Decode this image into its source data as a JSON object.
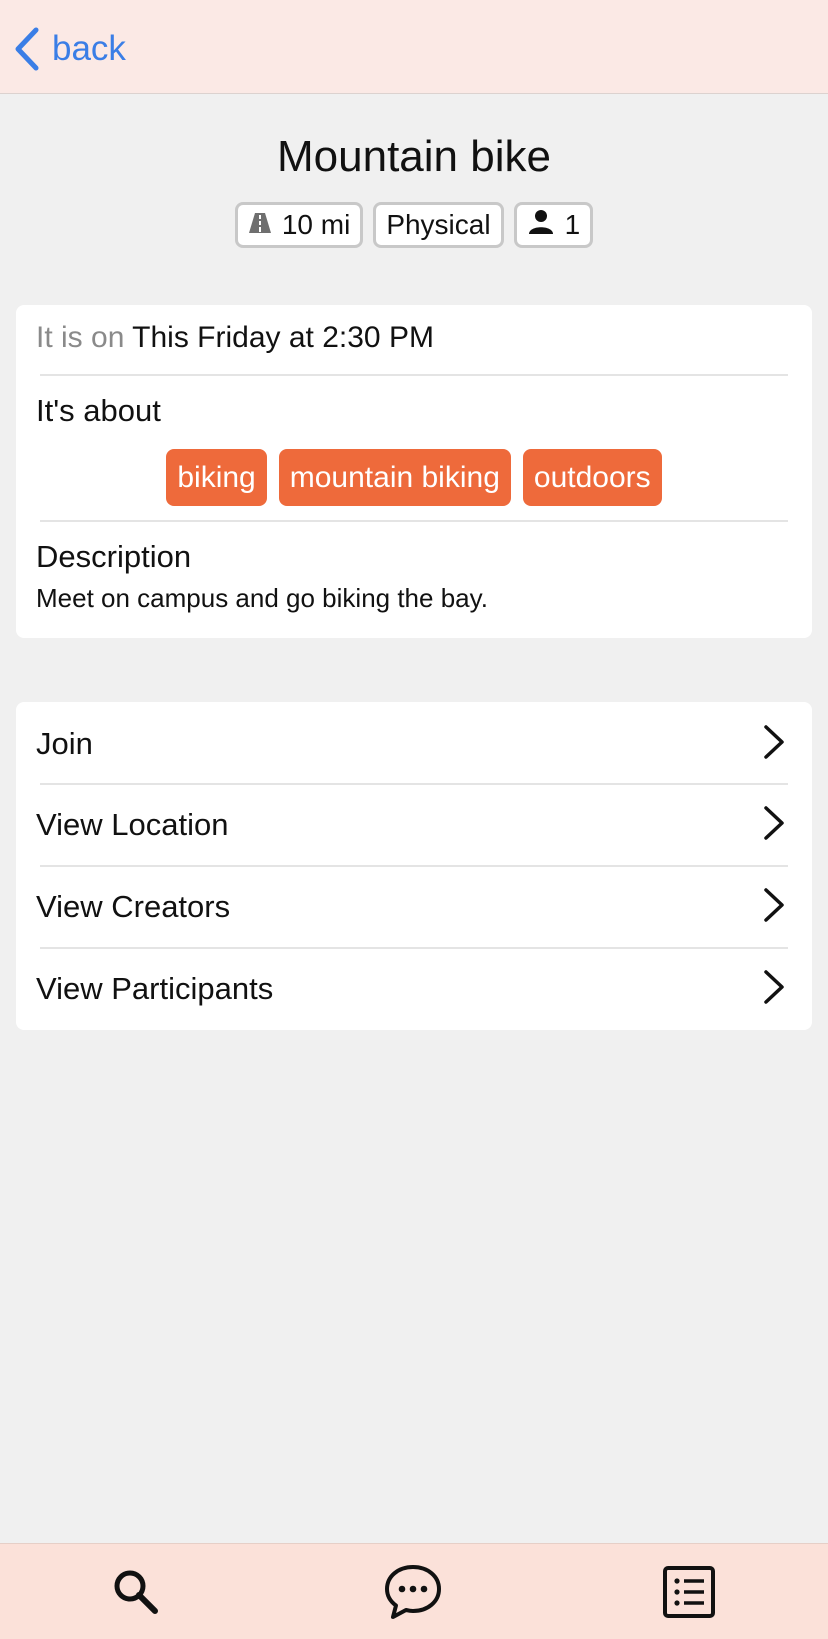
{
  "header": {
    "back_label": "back"
  },
  "event": {
    "title": "Mountain bike",
    "chips": {
      "distance": "10 mi",
      "category": "Physical",
      "participants": "1"
    },
    "datetime_prefix": "It is on",
    "datetime_value": "This Friday at 2:30 PM",
    "about_label": "It's about",
    "tags": [
      "biking",
      "mountain biking",
      "outdoors"
    ],
    "description_label": "Description",
    "description": "Meet on campus and go biking the bay."
  },
  "actions": [
    {
      "label": "Join"
    },
    {
      "label": "View Location"
    },
    {
      "label": "View Creators"
    },
    {
      "label": "View Participants"
    }
  ],
  "tabbar": {
    "icons": [
      "search-icon",
      "chat-bubble-icon",
      "list-icon"
    ]
  },
  "colors": {
    "accent_blue": "#3a7ee6",
    "tag_orange": "#ee6a3b",
    "header_bg": "#fbe9e5",
    "tabbar_bg": "#fbe1d9"
  }
}
